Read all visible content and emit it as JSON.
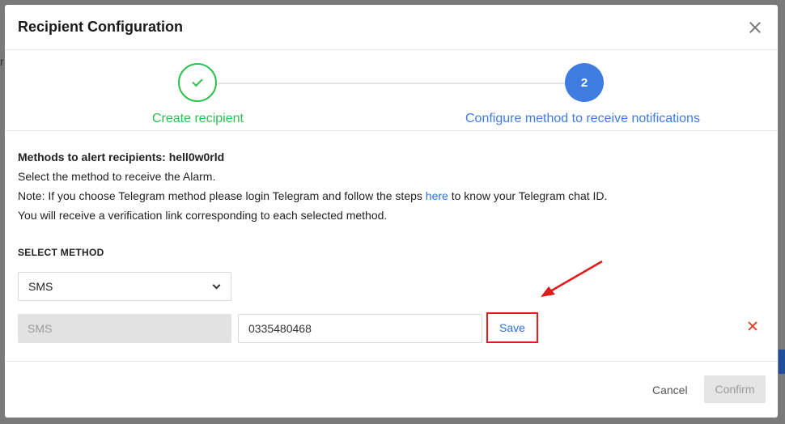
{
  "modal": {
    "title": "Recipient Configuration"
  },
  "stepper": {
    "steps": [
      {
        "label": "Create recipient",
        "state": "completed"
      },
      {
        "number": "2",
        "label": "Configure method to receive notifications",
        "state": "active"
      }
    ]
  },
  "content": {
    "methods_heading": "Methods to alert recipients: hell0w0rld",
    "line1": "Select the method to receive the Alarm.",
    "note_prefix": "Note: If you choose Telegram method please login Telegram and follow the steps ",
    "note_link": "here",
    "note_suffix": " to know your Telegram chat ID.",
    "line3": "You will receive a verification link corresponding to each selected method.",
    "select_method_label": "SELECT METHOD",
    "select_value": "SMS",
    "method_rows": [
      {
        "method": "SMS",
        "value": "0335480468",
        "save_label": "Save"
      }
    ]
  },
  "footer": {
    "cancel_label": "Cancel",
    "confirm_label": "Confirm"
  },
  "colors": {
    "completed": "#2ec04f",
    "active": "#3f7ce0",
    "highlight": "#e01b1b",
    "link": "#2d6fd6"
  }
}
